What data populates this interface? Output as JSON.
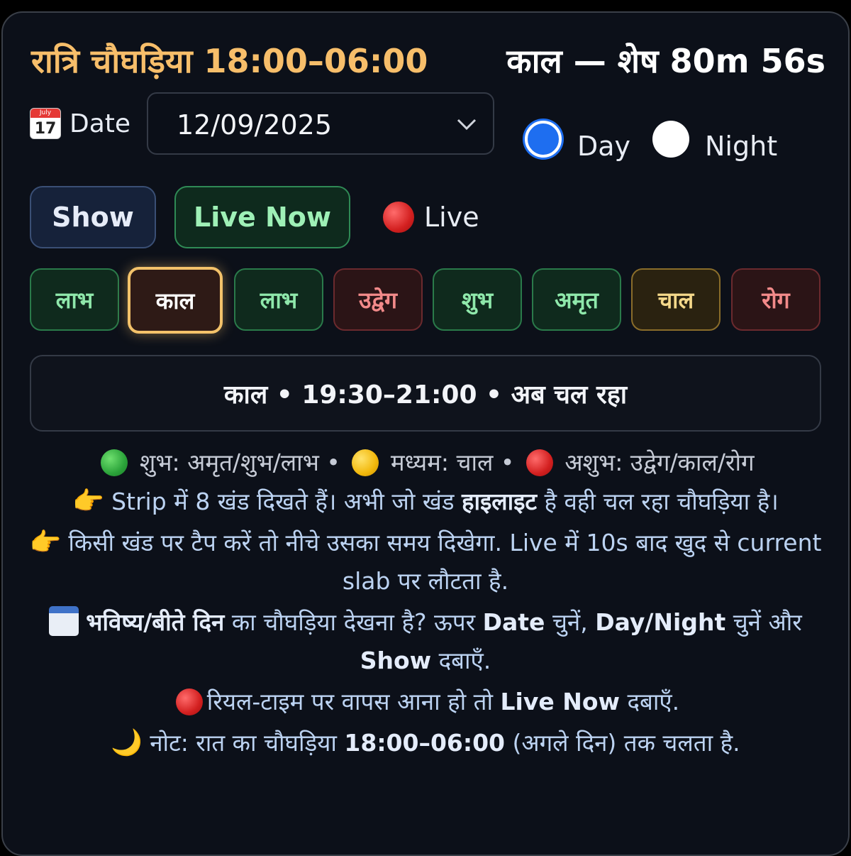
{
  "header": {
    "title": "रात्रि चौघड़िया 18:00–06:00",
    "remaining": "काल — शेष 80m 56s"
  },
  "date_row": {
    "icon": "calendar-icon",
    "icon_month": "July",
    "icon_day": "17",
    "label": "Date",
    "value": "12/09/2025",
    "day_label": "Day",
    "night_label": "Night",
    "selected_mode": "Day"
  },
  "actions": {
    "show_label": "Show",
    "live_now_label": "Live Now",
    "live_indicator": "Live"
  },
  "strip": {
    "slabs": [
      {
        "name": "लाभ",
        "quality": "good",
        "active": false
      },
      {
        "name": "काल",
        "quality": "bad",
        "active": true
      },
      {
        "name": "लाभ",
        "quality": "good",
        "active": false
      },
      {
        "name": "उद्वेग",
        "quality": "bad",
        "active": false
      },
      {
        "name": "शुभ",
        "quality": "good",
        "active": false
      },
      {
        "name": "अमृत",
        "quality": "good",
        "active": false
      },
      {
        "name": "चाल",
        "quality": "mid",
        "active": false
      },
      {
        "name": "रोग",
        "quality": "bad",
        "active": false
      }
    ]
  },
  "info": {
    "text": "काल • 19:30–21:00 • अब चल रहा"
  },
  "legend": {
    "good": "शुभ: अमृत/शुभ/लाभ",
    "mid": "मध्यम: चाल",
    "bad": "अशुभ: उद्वेग/काल/रोग",
    "sep": "•"
  },
  "notes": {
    "n1_a": "Strip में 8 खंड दिखते हैं। अभी जो खंड ",
    "n1_b": "हाइलाइट",
    "n1_c": " है वही चल रहा चौघड़िया है।",
    "n2": "किसी खंड पर टैप करें तो नीचे उसका समय दिखेगा. Live में 10s बाद खुद से current slab पर लौटता है.",
    "n3_a": "भविष्य/बीते दिन",
    "n3_b": " का चौघड़िया देखना है? ऊपर ",
    "n3_c": "Date",
    "n3_d": " चुनें, ",
    "n3_e": "Day/Night",
    "n3_f": " चुनें और ",
    "n3_g": "Show",
    "n3_h": " दबाएँ.",
    "n4_a": "रियल-टाइम पर वापस आना हो तो ",
    "n4_b": "Live Now",
    "n4_c": " दबाएँ.",
    "n5_a": "नोट: रात का चौघड़िया ",
    "n5_b": "18:00–06:00",
    "n5_c": " (अगले दिन) तक चलता है."
  },
  "colors": {
    "title": "#f7be6a",
    "good": "#8fe8ab",
    "bad": "#f28a8a",
    "mid": "#f4d88a",
    "active_border": "#f3c26a",
    "radio_checked": "#1e6ef0"
  }
}
